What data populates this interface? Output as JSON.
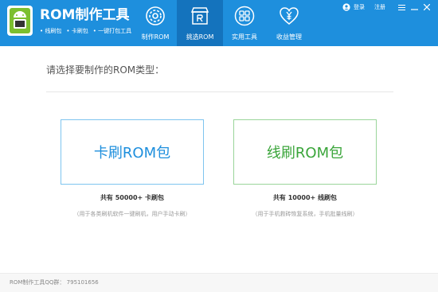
{
  "app": {
    "title": "ROM制作工具",
    "subtitle_items": [
      "• 线刷包",
      "• 卡刷包",
      "• 一键打包工具"
    ]
  },
  "nav": {
    "items": [
      {
        "label": "制作ROM",
        "icon": "gear-icon",
        "active": false
      },
      {
        "label": "挑选ROM",
        "icon": "store-icon",
        "active": true
      },
      {
        "label": "实用工具",
        "icon": "grid-icon",
        "active": false
      },
      {
        "label": "收益管理",
        "icon": "heart-yen-icon",
        "active": false
      }
    ]
  },
  "topbar": {
    "login_label": "登录",
    "register_label": "注册"
  },
  "main": {
    "prompt": "请选择要制作的ROM类型：",
    "cards": [
      {
        "label": "卡刷ROM包",
        "count": "共有 50000+ 卡刷包",
        "description": "（用于各类刷机软件一键刷机，用户手动卡刷）"
      },
      {
        "label": "线刷ROM包",
        "count": "共有 10000+ 线刷包",
        "description": "（用于手机救砖恢复系统，手机批量线刷）"
      }
    ]
  },
  "footer": {
    "text": "ROM制作工具QQ群：  795101656"
  },
  "colors": {
    "header": "#1e8fdd",
    "nav_active": "#1473bd",
    "card_a": "#1e8fdd",
    "card_b": "#3aa53a"
  }
}
